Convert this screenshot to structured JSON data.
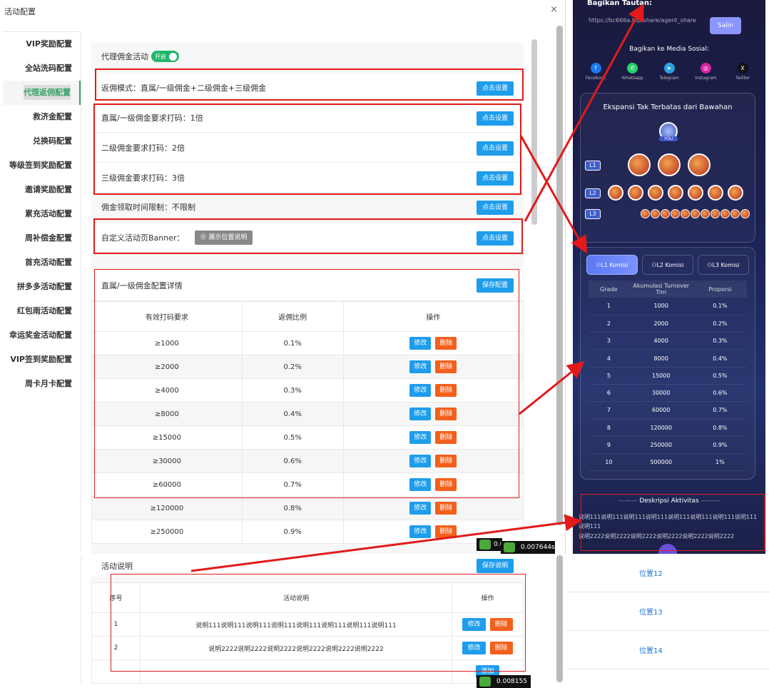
{
  "window": {
    "title": "活动配置",
    "close": "×"
  },
  "sidebar": {
    "items": [
      {
        "label": "VIP奖励配置"
      },
      {
        "label": "全站洗码配置"
      },
      {
        "label": "代理返佣配置"
      },
      {
        "label": "救济金配置"
      },
      {
        "label": "兑换码配置"
      },
      {
        "label": "等级签到奖励配置"
      },
      {
        "label": "邀请奖励配置"
      },
      {
        "label": "累充活动配置"
      },
      {
        "label": "周补偿金配置"
      },
      {
        "label": "首充活动配置"
      },
      {
        "label": "拼多多活动配置"
      },
      {
        "label": "红包雨活动配置"
      },
      {
        "label": "幸运奖金活动配置"
      },
      {
        "label": "VIP签到奖励配置"
      },
      {
        "label": "周卡月卡配置"
      }
    ],
    "active_index": 2
  },
  "agent": {
    "activity_label": "代理佣金活动",
    "toggle_label": "开启",
    "rows": [
      {
        "text": "返佣模式：直属/一级佣金+二级佣金+三级佣金",
        "btn": "点击设置"
      },
      {
        "text": "直属/一级佣金要求打码：1倍",
        "btn": "点击设置"
      },
      {
        "text": "二级佣金要求打码：2倍",
        "btn": "点击设置"
      },
      {
        "text": "三级佣金要求打码：3倍",
        "btn": "点击设置"
      },
      {
        "text": "佣金领取时间限制：不限制",
        "btn": "点击设置"
      },
      {
        "text": "自定义活动页Banner：",
        "btn": "点击设置"
      }
    ],
    "banner_hint": "展示位置说明"
  },
  "commission_table": {
    "title": "直属/一级佣金配置详情",
    "save_btn": "保存配置",
    "headers": [
      "有效打码要求",
      "返佣比例",
      "操作"
    ],
    "edit": "修改",
    "del": "删除",
    "rows": [
      [
        "≥1000",
        "0.1%"
      ],
      [
        "≥2000",
        "0.2%"
      ],
      [
        "≥4000",
        "0.3%"
      ],
      [
        "≥8000",
        "0.4%"
      ],
      [
        "≥15000",
        "0.5%"
      ],
      [
        "≥30000",
        "0.6%"
      ],
      [
        "≥60000",
        "0.7%"
      ],
      [
        "≥120000",
        "0.8%"
      ],
      [
        "≥250000",
        "0.9%"
      ]
    ]
  },
  "description": {
    "title": "活动说明",
    "save_btn": "保存说明",
    "headers": [
      "序号",
      "活动说明",
      "操作"
    ],
    "edit": "修改",
    "del": "删除",
    "rows": [
      [
        "1",
        "说明111说明111说明111说明111说明111说明111说明111说明111"
      ],
      [
        "2",
        "说明2222说明2222说明2222说明2222说明2222说明2222"
      ]
    ],
    "add_btn": "添加"
  },
  "timers": {
    "a": "0.0",
    "b": "0.007644s",
    "c": "0.008155"
  },
  "mobile": {
    "share_label": "Bagikan Tautan:",
    "share_url": "https://bc666a.top/share/agent_share",
    "copy_btn": "Salin",
    "social_label": "Bagikan ke Media Sosial:",
    "social": [
      {
        "name": "Facebook",
        "color": "#1877f2",
        "glyph": "f"
      },
      {
        "name": "Whatsapp",
        "color": "#25d366",
        "glyph": "✆"
      },
      {
        "name": "Telegram",
        "color": "#2aa3e0",
        "glyph": "➤"
      },
      {
        "name": "Instagram",
        "color": "#d6249f",
        "glyph": "◎"
      },
      {
        "name": "Twitter",
        "color": "#111111",
        "glyph": "X"
      }
    ],
    "expansion_title": "Ekspansi Tak Terbatas dari Bawahan",
    "you_label": "YOU",
    "levels": [
      "L1",
      "L2",
      "L3"
    ],
    "tabs": [
      "L1 Komisi",
      "L2 Komisi",
      "L3 Komisi"
    ],
    "table_headers": [
      "Grade",
      "Akumulasi Turnover Tim",
      "Proporsi"
    ],
    "table_rows": [
      [
        "1",
        "1000",
        "0.1%"
      ],
      [
        "2",
        "2000",
        "0.2%"
      ],
      [
        "3",
        "4000",
        "0.3%"
      ],
      [
        "4",
        "8000",
        "0.4%"
      ],
      [
        "5",
        "15000",
        "0.5%"
      ],
      [
        "6",
        "30000",
        "0.6%"
      ],
      [
        "7",
        "60000",
        "0.7%"
      ],
      [
        "8",
        "120000",
        "0.8%"
      ],
      [
        "9",
        "250000",
        "0.9%"
      ],
      [
        "10",
        "500000",
        "1%"
      ]
    ],
    "desc_title": "Deskripsi Aktivitas",
    "desc_lines": [
      "说明111说明111说明111说明111说明111说明111说明111说明111说明111",
      "说明2222说明2222说明2222说明2222说明2222说明2222"
    ]
  },
  "right_grid": {
    "items": [
      "位置12",
      "位置13",
      "位置14"
    ]
  }
}
